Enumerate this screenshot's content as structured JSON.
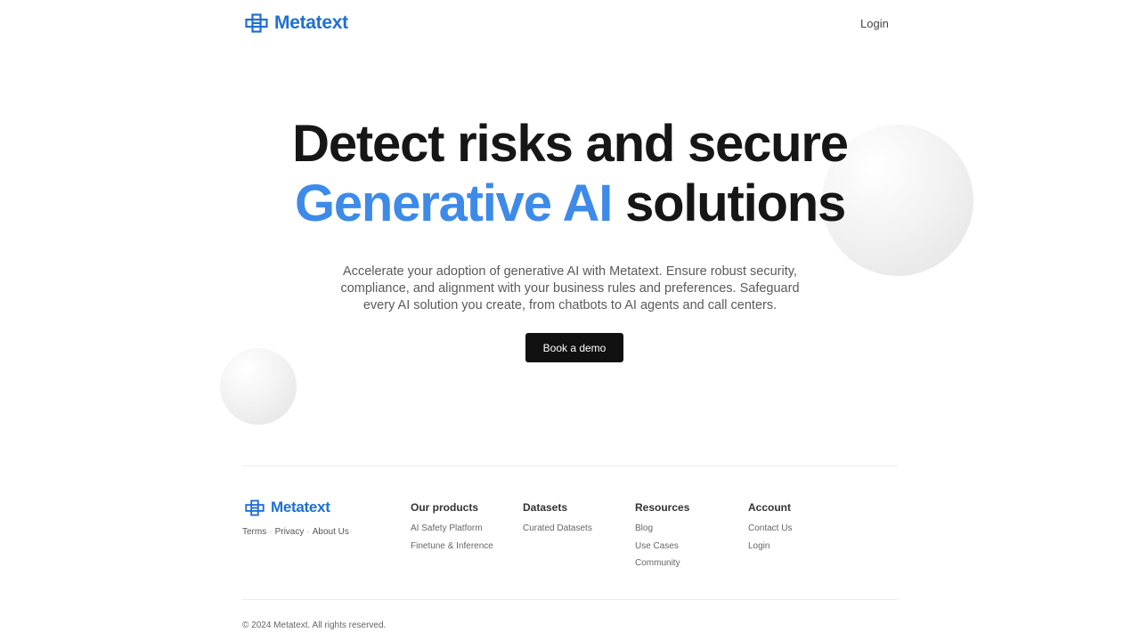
{
  "brand": {
    "name": "Metatext",
    "color": "#1f6fd1",
    "logo_icon": "grid-cross-logo-icon"
  },
  "nav": {
    "login_label": "Login"
  },
  "hero": {
    "title_line1": "Detect risks and secure",
    "title_accent": "Generative AI",
    "title_rest": " solutions",
    "subtitle": "Accelerate your adoption of generative AI with Metatext. Ensure robust security, compliance, and alignment with your business rules and preferences. Safeguard every AI solution you create, from chatbots to AI agents and call centers.",
    "cta_label": "Book a demo",
    "accent_color": "#3d8ae8"
  },
  "footer": {
    "legal_links": [
      "Terms",
      "Privacy",
      "About Us"
    ],
    "columns": [
      {
        "heading": "Our products",
        "items": [
          "AI Safety Platform",
          "Finetune & Inference"
        ]
      },
      {
        "heading": "Datasets",
        "items": [
          "Curated Datasets"
        ]
      },
      {
        "heading": "Resources",
        "items": [
          "Blog",
          "Use Cases",
          "Community"
        ]
      },
      {
        "heading": "Account",
        "items": [
          "Contact Us",
          "Login"
        ]
      }
    ],
    "copyright": "© 2024 Metatext. All rights reserved."
  }
}
